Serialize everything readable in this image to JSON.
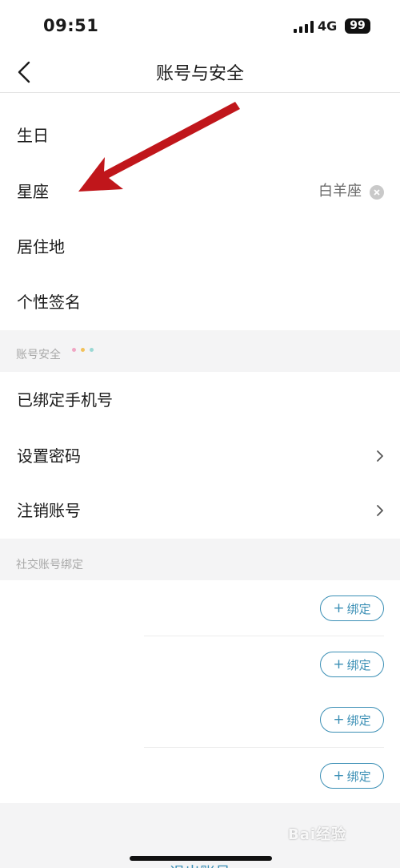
{
  "status_bar": {
    "time": "09:51",
    "network": "4G",
    "battery": "99"
  },
  "nav": {
    "title": "账号与安全"
  },
  "profile_items": [
    {
      "label": "生日",
      "value": ""
    },
    {
      "label": "星座",
      "value": "白羊座"
    },
    {
      "label": "居住地",
      "value": ""
    },
    {
      "label": "个性签名",
      "value": ""
    }
  ],
  "security_section": {
    "header": "账号安全",
    "dot_colors": [
      "#f0a6c4",
      "#f2c15a",
      "#9ad8d4"
    ],
    "items": [
      {
        "label": "已绑定手机号"
      },
      {
        "label": "设置密码"
      },
      {
        "label": "注销账号"
      }
    ]
  },
  "social_section": {
    "header": "社交账号绑定",
    "bind_label": "绑定",
    "bind_plus": "+"
  },
  "footer": {
    "logout": "退出账号"
  },
  "annotation": {
    "arrow_color": "#c0161b"
  },
  "watermark": "Bai经验"
}
